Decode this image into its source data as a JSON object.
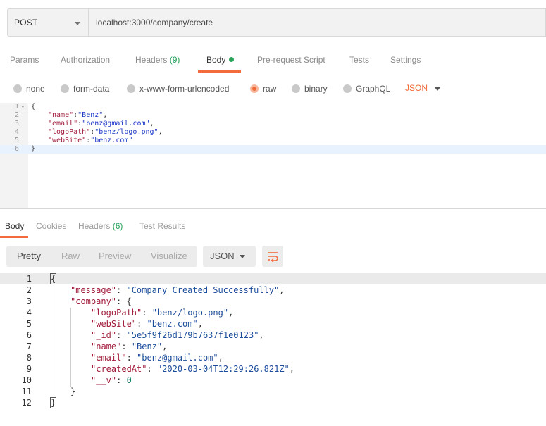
{
  "request": {
    "method": "POST",
    "url": "localhost:3000/company/create"
  },
  "request_tabs": {
    "params": "Params",
    "authorization": "Authorization",
    "headers": "Headers",
    "headers_count": "(9)",
    "body": "Body",
    "pre_request": "Pre-request Script",
    "tests": "Tests",
    "settings": "Settings"
  },
  "body_types": {
    "none": "none",
    "form_data": "form-data",
    "urlencoded": "x-www-form-urlencoded",
    "raw": "raw",
    "binary": "binary",
    "graphql": "GraphQL",
    "selected": "raw",
    "format": "JSON"
  },
  "request_body_lines": [
    {
      "num": "1",
      "text": "{"
    },
    {
      "num": "2",
      "key": "\"name\"",
      "value": "\"Benz\"",
      "tail": ","
    },
    {
      "num": "3",
      "key": "\"email\"",
      "value": "\"benz@gmail.com\"",
      "tail": ","
    },
    {
      "num": "4",
      "key": "\"logoPath\"",
      "value": "\"benz/logo.png\"",
      "tail": ","
    },
    {
      "num": "5",
      "key": "\"webSite\"",
      "value": "\"benz.com\"",
      "tail": ""
    },
    {
      "num": "6",
      "text": "}"
    }
  ],
  "response_tabs": {
    "body": "Body",
    "cookies": "Cookies",
    "headers": "Headers",
    "headers_count": "(6)",
    "test_results": "Test Results"
  },
  "response_view": {
    "pretty": "Pretty",
    "raw": "Raw",
    "preview": "Preview",
    "visualize": "Visualize",
    "format": "JSON"
  },
  "response_lines": {
    "n1": "1",
    "n2": "2",
    "n3": "3",
    "n4": "4",
    "n5": "5",
    "n6": "6",
    "n7": "7",
    "n8": "8",
    "n9": "9",
    "n10": "10",
    "n11": "11",
    "n12": "12",
    "message_key": "\"message\"",
    "message_value": "\"Company Created Successfully\"",
    "company_key": "\"company\"",
    "logoPath_key": "\"logoPath\"",
    "logoPath_value_prefix": "\"benz/",
    "logoPath_value_link": "logo.png",
    "logoPath_value_suffix": "\"",
    "webSite_key": "\"webSite\"",
    "webSite_value": "\"benz.com\"",
    "id_key": "\"_id\"",
    "id_value": "\"5e5f9f26d179b7637f1e0123\"",
    "name_key": "\"name\"",
    "name_value": "\"Benz\"",
    "email_key": "\"email\"",
    "email_value": "\"benz@gmail.com\"",
    "createdAt_key": "\"createdAt\"",
    "createdAt_value": "\"2020-03-04T12:29:26.821Z\"",
    "v_key": "\"__v\"",
    "v_value": "0"
  },
  "colors": {
    "accent": "#f26b3a",
    "count_green": "#27a35a"
  },
  "icons": {
    "method_dropdown": "chevron-down-icon",
    "wrap": "wrap-lines-icon"
  }
}
